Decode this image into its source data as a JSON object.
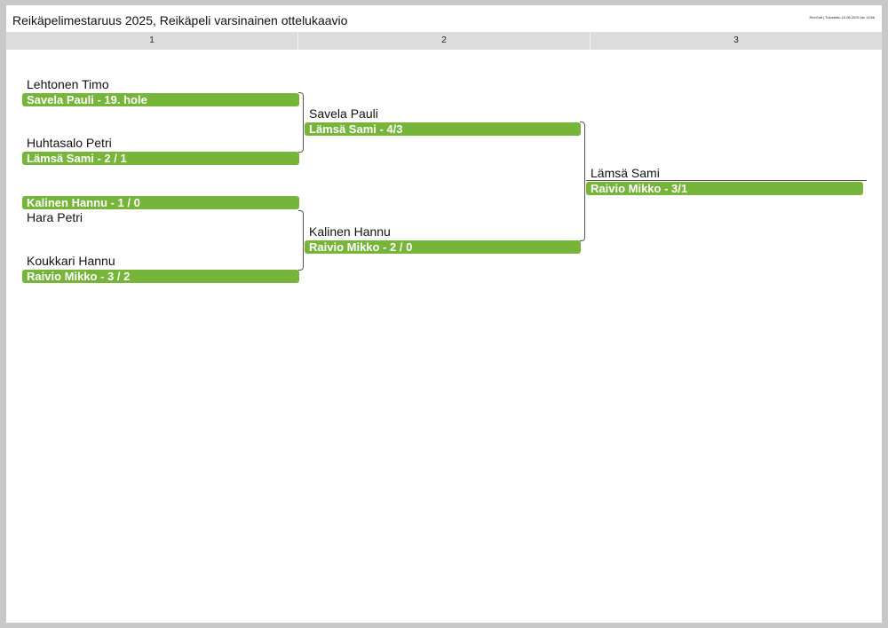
{
  "header": {
    "title": "Reikäpelimestaruus 2025, Reikäpeli varsinainen ottelukaavio",
    "stamp": "RevGolf | Tulostettu 10.08.2025 klo 13:56"
  },
  "rounds": [
    "1",
    "2",
    "3"
  ],
  "round1": {
    "m1_top": "Lehtonen Timo",
    "m1_winner": "Savela Pauli - 19. hole",
    "m2_top": "Huhtasalo Petri",
    "m2_winner": "Lämsä Sami - 2 / 1",
    "m3_winner": "Kalinen Hannu - 1 / 0",
    "m3_bottom": "Hara Petri",
    "m4_top": "Koukkari Hannu",
    "m4_winner": "Raivio Mikko - 3 / 2"
  },
  "round2": {
    "m1_top": "Savela Pauli",
    "m1_winner": "Lämsä Sami - 4/3",
    "m2_top": "Kalinen Hannu",
    "m2_winner": "Raivio Mikko - 2 / 0"
  },
  "round3": {
    "final_top": "Lämsä Sami",
    "final_winner": "Raivio Mikko - 3/1"
  },
  "colors": {
    "winner_bar": "#76b43a",
    "round_bar": "#dcdcdc",
    "frame": "#c8c8c8"
  }
}
